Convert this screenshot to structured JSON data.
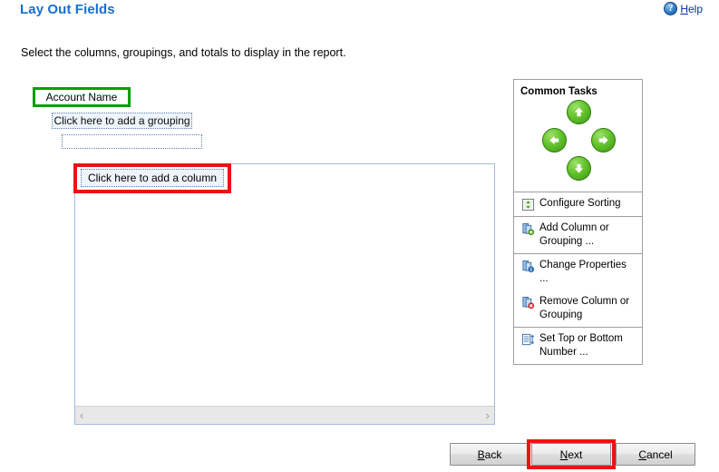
{
  "header": {
    "title": "Lay Out Fields",
    "help_label": "Help",
    "help_icon": "help-question-icon"
  },
  "instruction": "Select the columns, groupings, and totals to display in the report.",
  "layout": {
    "field_account": "Account Name",
    "grouping_placeholder": "Click here to add a grouping",
    "empty_grouping_placeholder": "",
    "column_placeholder": "Click here to add a column",
    "scroll_left_icon": "‹",
    "scroll_right_icon": "›"
  },
  "common_tasks": {
    "title": "Common Tasks",
    "arrows": [
      {
        "name": "move-up-button",
        "direction": "up"
      },
      {
        "name": "move-left-button",
        "direction": "left"
      },
      {
        "name": "move-right-button",
        "direction": "right"
      },
      {
        "name": "move-down-button",
        "direction": "down"
      }
    ],
    "items": [
      {
        "label": "Configure Sorting",
        "icon": "sort-icon"
      },
      {
        "label": "Add Column or Grouping ...",
        "icon": "add-column-icon"
      },
      {
        "label": "Change Properties ...",
        "icon": "properties-icon"
      },
      {
        "label": "Remove Column or Grouping",
        "icon": "remove-column-icon"
      },
      {
        "label": "Set Top or Bottom Number ...",
        "icon": "top-bottom-icon"
      }
    ]
  },
  "buttons": {
    "back": {
      "prefix": "",
      "accesskey": "B",
      "suffix": "ack"
    },
    "next": {
      "prefix": "",
      "accesskey": "N",
      "suffix": "ext"
    },
    "cancel": {
      "prefix": "",
      "accesskey": "C",
      "suffix": "ancel"
    }
  },
  "annotations": {
    "highlight_color": "#ee1111",
    "field_highlight_color": "#00a000"
  }
}
